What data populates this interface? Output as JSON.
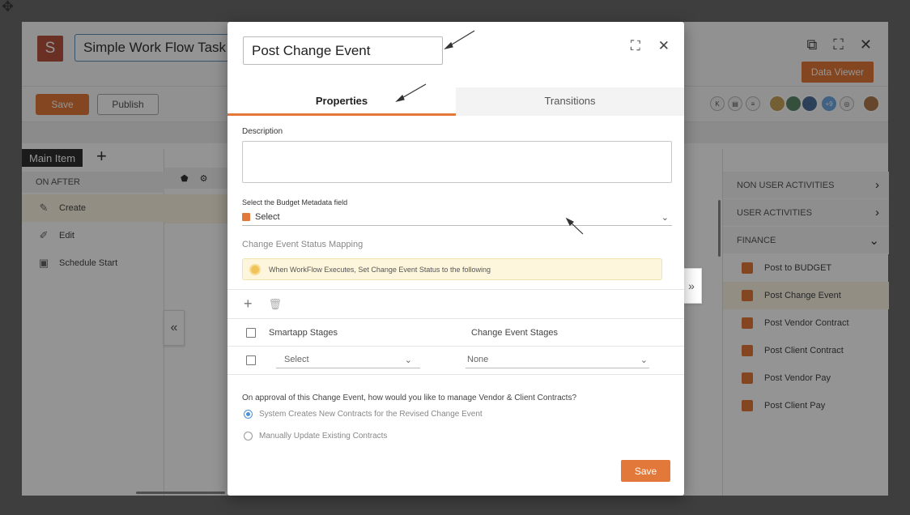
{
  "app": {
    "logo_letter": "S",
    "title": "Simple Work Flow Task",
    "data_viewer_label": "Data Viewer",
    "save_label": "Save",
    "publish_label": "Publish",
    "collab_count": "+9"
  },
  "left_pane": {
    "main_tab": "Main Item",
    "add_symbol": "+",
    "section": "ON AFTER",
    "items": [
      {
        "label": "Create",
        "icon": "create-icon"
      },
      {
        "label": "Edit",
        "icon": "edit-icon"
      },
      {
        "label": "Schedule Start",
        "icon": "schedule-icon"
      }
    ]
  },
  "right_pane": {
    "sections": [
      {
        "label": "NON USER ACTIVITIES",
        "chevron": ">"
      },
      {
        "label": "USER ACTIVITIES",
        "chevron": ">"
      },
      {
        "label": "FINANCE",
        "chevron": "v"
      }
    ],
    "items": [
      {
        "label": "Post to BUDGET"
      },
      {
        "label": "Post Change Event"
      },
      {
        "label": "Post Vendor Contract"
      },
      {
        "label": "Post Client Contract"
      },
      {
        "label": "Post Vendor Pay"
      },
      {
        "label": "Post Client Pay"
      }
    ]
  },
  "modal": {
    "title": "Post Change Event",
    "tabs": [
      {
        "label": "Properties"
      },
      {
        "label": "Transitions"
      }
    ],
    "description_label": "Description",
    "budget_field_label": "Select the Budget Metadata field",
    "budget_field_value": "Select",
    "status_mapping_label": "Change Event Status Mapping",
    "note_text": "When WorkFlow Executes, Set Change Event Status to the following",
    "grid": {
      "col1": "Smartapp Stages",
      "col2": "Change Event Stages",
      "row_select": "Select",
      "row_none": "None"
    },
    "question": "On approval of this Change Event, how would you like to manage Vendor & Client Contracts?",
    "options": [
      {
        "label": "System Creates New Contracts for the Revised Change Event"
      },
      {
        "label": "Manually Update Existing Contracts"
      }
    ],
    "save_label": "Save"
  },
  "colors": {
    "accent": "#e2793a",
    "highlight": "#fbf5e2"
  }
}
